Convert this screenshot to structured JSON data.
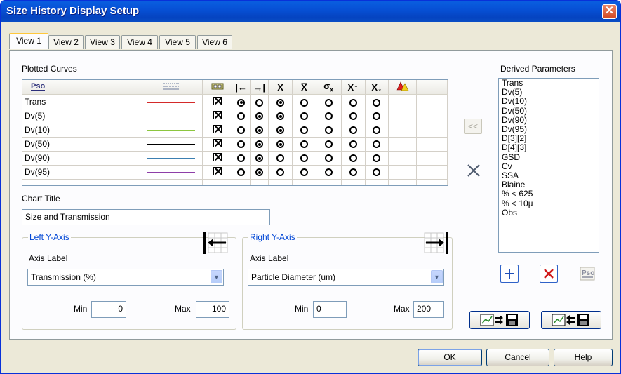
{
  "window": {
    "title": "Size History Display Setup",
    "close_label": "✕"
  },
  "tabs": [
    {
      "label": "View 1",
      "active": true
    },
    {
      "label": "View 2",
      "active": false
    },
    {
      "label": "View 3",
      "active": false
    },
    {
      "label": "View 4",
      "active": false
    },
    {
      "label": "View 5",
      "active": false
    },
    {
      "label": "View 6",
      "active": false
    }
  ],
  "plotted_curves": {
    "label": "Plotted Curves",
    "header_icons": [
      "parameter-icon",
      "line-style-icon",
      "visible-icon",
      "left-axis-icon",
      "right-axis-icon",
      "x-mean-icon",
      "x-bar-icon",
      "sigma-x-icon",
      "x-up-icon",
      "x-down-icon",
      "warning-icon"
    ],
    "header_text": {
      "left_axis": "|←",
      "right_axis": "→|",
      "x": "X",
      "xbar": "X̅",
      "sigma": "σ",
      "sigma_sub": "x",
      "xup": "X↑",
      "xdown": "X↓"
    },
    "rows": [
      {
        "name": "Trans",
        "color": "#d42a2a",
        "checked": true,
        "left": true,
        "right": false,
        "x": true
      },
      {
        "name": "Dv(5)",
        "color": "#f0a070",
        "checked": true,
        "left": false,
        "right": true,
        "x": true
      },
      {
        "name": "Dv(10)",
        "color": "#8cc63f",
        "checked": true,
        "left": false,
        "right": true,
        "x": true
      },
      {
        "name": "Dv(50)",
        "color": "#000000",
        "checked": true,
        "left": false,
        "right": true,
        "x": true
      },
      {
        "name": "Dv(90)",
        "color": "#3c7fb1",
        "checked": true,
        "left": false,
        "right": true,
        "x": false
      },
      {
        "name": "Dv(95)",
        "color": "#8e3ea8",
        "checked": true,
        "left": false,
        "right": true,
        "x": false
      }
    ]
  },
  "chart_title": {
    "label": "Chart Title",
    "value": "Size and Transmission"
  },
  "left_axis": {
    "title": "Left Y-Axis",
    "axis_label": "Axis Label",
    "value": "Transmission (%)",
    "min_label": "Min",
    "min": "0",
    "max_label": "Max",
    "max": "100"
  },
  "right_axis": {
    "title": "Right Y-Axis",
    "axis_label": "Axis Label",
    "value": "Particle Diameter (um)",
    "min_label": "Min",
    "min": "0",
    "max_label": "Max",
    "max": "200"
  },
  "derived": {
    "label": "Derived Parameters",
    "items": [
      "Trans",
      "Dv(5)",
      "Dv(10)",
      "Dv(50)",
      "Dv(90)",
      "Dv(95)",
      "D[3][2]",
      "D[4][3]",
      "GSD",
      "Cv",
      "SSA",
      "Blaine",
      "% < 625",
      "% < 10µ",
      "Obs"
    ]
  },
  "move_left_label": "<<",
  "buttons": {
    "ok": "OK",
    "cancel": "Cancel",
    "help": "Help"
  }
}
